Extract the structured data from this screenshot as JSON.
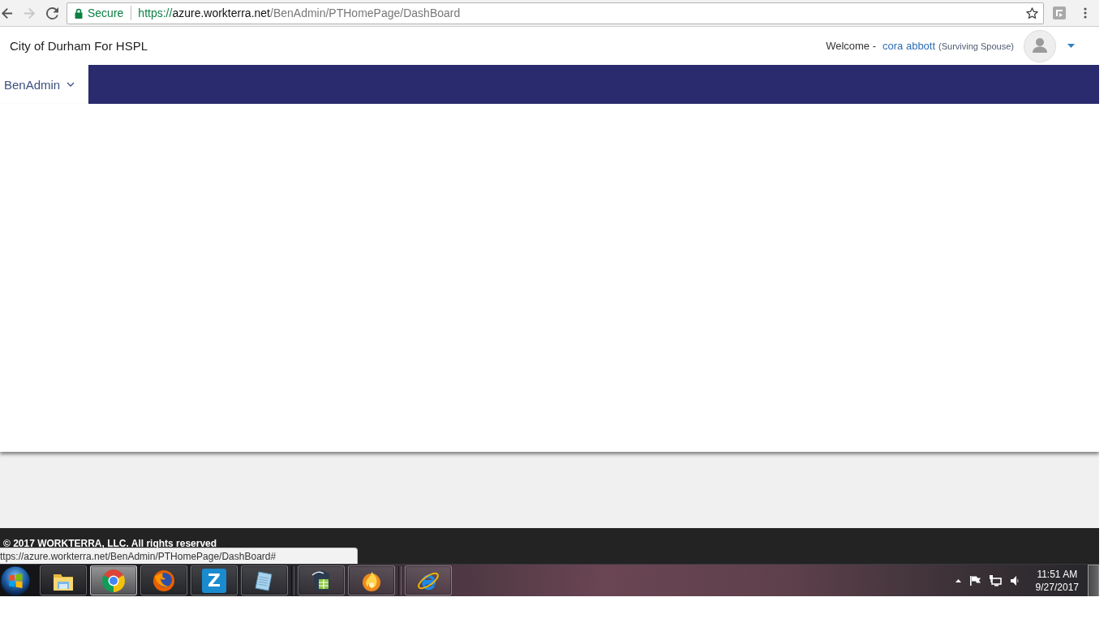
{
  "browser": {
    "nav_buttons": [
      {
        "kind": "back",
        "disabled": false
      },
      {
        "kind": "forward",
        "disabled": true
      },
      {
        "kind": "reload",
        "disabled": false
      }
    ],
    "security_label": "Secure",
    "url": {
      "scheme": "https://",
      "host": "azure.workterra.net",
      "path": "/BenAdmin/PTHomePage/DashBoard"
    }
  },
  "header": {
    "title": "City of Durham For HSPL",
    "welcome": "Welcome -",
    "user_name": "cora abbott",
    "user_role": "(Surviving Spouse)"
  },
  "nav": {
    "items": [
      {
        "label": "BenAdmin",
        "selected": true
      }
    ]
  },
  "footer": {
    "copyright": "© 2017 WORKTERRA, LLC. All rights reserved"
  },
  "status_url": "ttps://azure.workterra.net/BenAdmin/PTHomePage/DashBoard#",
  "taskbar": {
    "groups": [
      {
        "apps": [
          {
            "kind": "folder",
            "selected": false
          },
          {
            "kind": "chrome",
            "selected": true
          },
          {
            "kind": "firefox",
            "selected": false
          },
          {
            "kind": "letter",
            "label": "Z",
            "selected": false
          },
          {
            "kind": "notepad",
            "selected": false
          }
        ]
      },
      {
        "apps": [
          {
            "kind": "spreadsheet",
            "selected": false
          },
          {
            "kind": "flame",
            "selected": false
          }
        ]
      },
      {
        "apps": [
          {
            "kind": "ie",
            "selected": false
          }
        ]
      }
    ],
    "clock": {
      "time": "11:51 AM",
      "date": "9/27/2017"
    }
  }
}
